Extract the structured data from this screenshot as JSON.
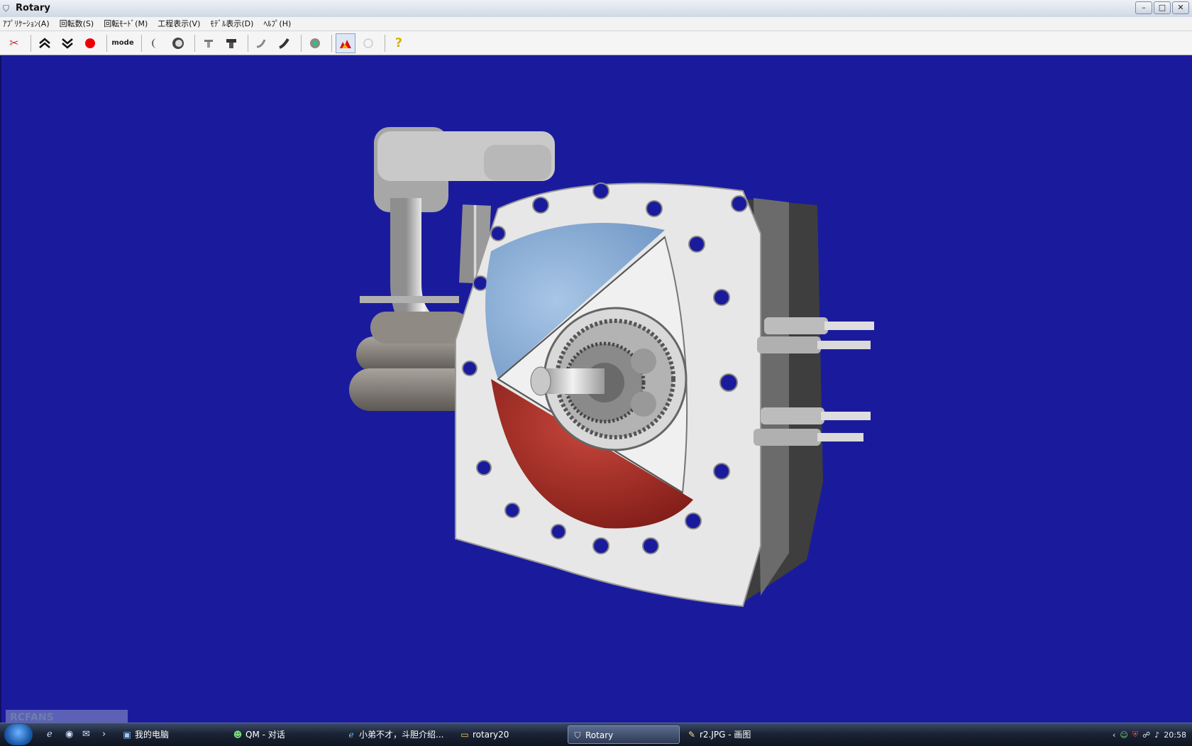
{
  "window": {
    "title": "Rotary",
    "app_icon": "rotary-app-icon",
    "controls": [
      "minimize",
      "maximize",
      "close"
    ]
  },
  "menu": {
    "items": [
      {
        "label": "ｱﾌﾟﾘｹｰｼｮﾝ(A)"
      },
      {
        "label": "回転数(S)"
      },
      {
        "label": "回転ﾓｰﾄﾞ(M)"
      },
      {
        "label": "工程表示(V)"
      },
      {
        "label": "ﾓﾃﾞﾙ表示(D)"
      },
      {
        "label": "ﾍﾙﾌﾟ(H)"
      }
    ]
  },
  "toolbar": {
    "mode_label": "mode",
    "buttons": [
      {
        "icon": "scissors-icon"
      },
      {
        "icon": "double-chevron-up-icon"
      },
      {
        "icon": "double-chevron-down-icon"
      },
      {
        "icon": "stop-red-circle-icon"
      },
      {
        "icon": "mode-text-icon"
      },
      {
        "icon": "crescent-icon"
      },
      {
        "icon": "ring-icon"
      },
      {
        "icon": "part-a-icon"
      },
      {
        "icon": "part-b-icon"
      },
      {
        "icon": "hose-a-icon"
      },
      {
        "icon": "hose-b-icon"
      },
      {
        "icon": "engine-icon"
      },
      {
        "icon": "flame-icon",
        "selected": true
      },
      {
        "icon": "disabled-circle-icon"
      },
      {
        "icon": "help-question-icon"
      }
    ]
  },
  "taskbar": {
    "tasks": [
      {
        "label": "我的电脑",
        "icon": "computer-icon"
      },
      {
        "label": "QM - 对话",
        "icon": "chat-icon"
      },
      {
        "label": "小弟不才，斗胆介绍...",
        "icon": "ie-icon"
      },
      {
        "label": "rotary20",
        "icon": "folder-icon"
      },
      {
        "label": "Rotary",
        "icon": "rotary-icon",
        "active": true
      },
      {
        "label": "r2.JPG - 画图",
        "icon": "paint-icon"
      }
    ],
    "clock": "20:58",
    "watermark": "RCFANS"
  },
  "colors": {
    "viewport_bg": "#1a1b9c",
    "housing": "#e6e6e6",
    "intake_chamber": "#8fb4dc",
    "combustion_chamber": "#b0352c"
  }
}
